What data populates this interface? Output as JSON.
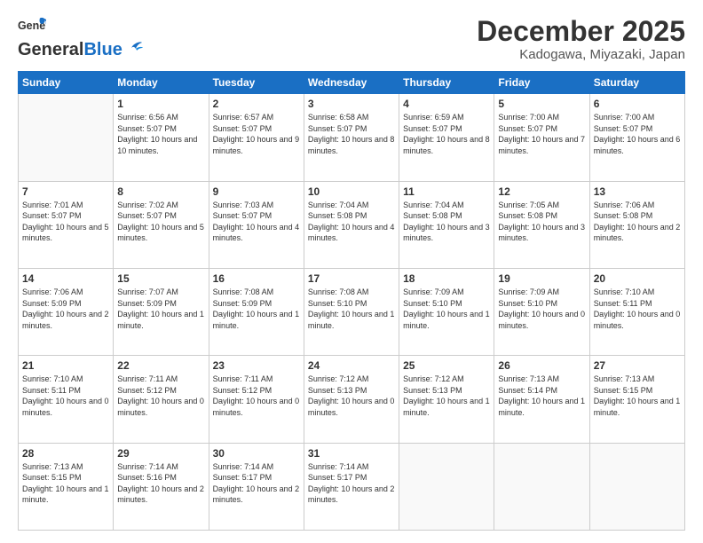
{
  "header": {
    "logo_general": "General",
    "logo_blue": "Blue",
    "month": "December 2025",
    "location": "Kadogawa, Miyazaki, Japan"
  },
  "days_of_week": [
    "Sunday",
    "Monday",
    "Tuesday",
    "Wednesday",
    "Thursday",
    "Friday",
    "Saturday"
  ],
  "weeks": [
    [
      {
        "day": "",
        "info": ""
      },
      {
        "day": "1",
        "info": "Sunrise: 6:56 AM\nSunset: 5:07 PM\nDaylight: 10 hours\nand 10 minutes."
      },
      {
        "day": "2",
        "info": "Sunrise: 6:57 AM\nSunset: 5:07 PM\nDaylight: 10 hours\nand 9 minutes."
      },
      {
        "day": "3",
        "info": "Sunrise: 6:58 AM\nSunset: 5:07 PM\nDaylight: 10 hours\nand 8 minutes."
      },
      {
        "day": "4",
        "info": "Sunrise: 6:59 AM\nSunset: 5:07 PM\nDaylight: 10 hours\nand 8 minutes."
      },
      {
        "day": "5",
        "info": "Sunrise: 7:00 AM\nSunset: 5:07 PM\nDaylight: 10 hours\nand 7 minutes."
      },
      {
        "day": "6",
        "info": "Sunrise: 7:00 AM\nSunset: 5:07 PM\nDaylight: 10 hours\nand 6 minutes."
      }
    ],
    [
      {
        "day": "7",
        "info": "Sunrise: 7:01 AM\nSunset: 5:07 PM\nDaylight: 10 hours\nand 5 minutes."
      },
      {
        "day": "8",
        "info": "Sunrise: 7:02 AM\nSunset: 5:07 PM\nDaylight: 10 hours\nand 5 minutes."
      },
      {
        "day": "9",
        "info": "Sunrise: 7:03 AM\nSunset: 5:07 PM\nDaylight: 10 hours\nand 4 minutes."
      },
      {
        "day": "10",
        "info": "Sunrise: 7:04 AM\nSunset: 5:08 PM\nDaylight: 10 hours\nand 4 minutes."
      },
      {
        "day": "11",
        "info": "Sunrise: 7:04 AM\nSunset: 5:08 PM\nDaylight: 10 hours\nand 3 minutes."
      },
      {
        "day": "12",
        "info": "Sunrise: 7:05 AM\nSunset: 5:08 PM\nDaylight: 10 hours\nand 3 minutes."
      },
      {
        "day": "13",
        "info": "Sunrise: 7:06 AM\nSunset: 5:08 PM\nDaylight: 10 hours\nand 2 minutes."
      }
    ],
    [
      {
        "day": "14",
        "info": "Sunrise: 7:06 AM\nSunset: 5:09 PM\nDaylight: 10 hours\nand 2 minutes."
      },
      {
        "day": "15",
        "info": "Sunrise: 7:07 AM\nSunset: 5:09 PM\nDaylight: 10 hours\nand 1 minute."
      },
      {
        "day": "16",
        "info": "Sunrise: 7:08 AM\nSunset: 5:09 PM\nDaylight: 10 hours\nand 1 minute."
      },
      {
        "day": "17",
        "info": "Sunrise: 7:08 AM\nSunset: 5:10 PM\nDaylight: 10 hours\nand 1 minute."
      },
      {
        "day": "18",
        "info": "Sunrise: 7:09 AM\nSunset: 5:10 PM\nDaylight: 10 hours\nand 1 minute."
      },
      {
        "day": "19",
        "info": "Sunrise: 7:09 AM\nSunset: 5:10 PM\nDaylight: 10 hours\nand 0 minutes."
      },
      {
        "day": "20",
        "info": "Sunrise: 7:10 AM\nSunset: 5:11 PM\nDaylight: 10 hours\nand 0 minutes."
      }
    ],
    [
      {
        "day": "21",
        "info": "Sunrise: 7:10 AM\nSunset: 5:11 PM\nDaylight: 10 hours\nand 0 minutes."
      },
      {
        "day": "22",
        "info": "Sunrise: 7:11 AM\nSunset: 5:12 PM\nDaylight: 10 hours\nand 0 minutes."
      },
      {
        "day": "23",
        "info": "Sunrise: 7:11 AM\nSunset: 5:12 PM\nDaylight: 10 hours\nand 0 minutes."
      },
      {
        "day": "24",
        "info": "Sunrise: 7:12 AM\nSunset: 5:13 PM\nDaylight: 10 hours\nand 0 minutes."
      },
      {
        "day": "25",
        "info": "Sunrise: 7:12 AM\nSunset: 5:13 PM\nDaylight: 10 hours\nand 1 minute."
      },
      {
        "day": "26",
        "info": "Sunrise: 7:13 AM\nSunset: 5:14 PM\nDaylight: 10 hours\nand 1 minute."
      },
      {
        "day": "27",
        "info": "Sunrise: 7:13 AM\nSunset: 5:15 PM\nDaylight: 10 hours\nand 1 minute."
      }
    ],
    [
      {
        "day": "28",
        "info": "Sunrise: 7:13 AM\nSunset: 5:15 PM\nDaylight: 10 hours\nand 1 minute."
      },
      {
        "day": "29",
        "info": "Sunrise: 7:14 AM\nSunset: 5:16 PM\nDaylight: 10 hours\nand 2 minutes."
      },
      {
        "day": "30",
        "info": "Sunrise: 7:14 AM\nSunset: 5:17 PM\nDaylight: 10 hours\nand 2 minutes."
      },
      {
        "day": "31",
        "info": "Sunrise: 7:14 AM\nSunset: 5:17 PM\nDaylight: 10 hours\nand 2 minutes."
      },
      {
        "day": "",
        "info": ""
      },
      {
        "day": "",
        "info": ""
      },
      {
        "day": "",
        "info": ""
      }
    ]
  ]
}
